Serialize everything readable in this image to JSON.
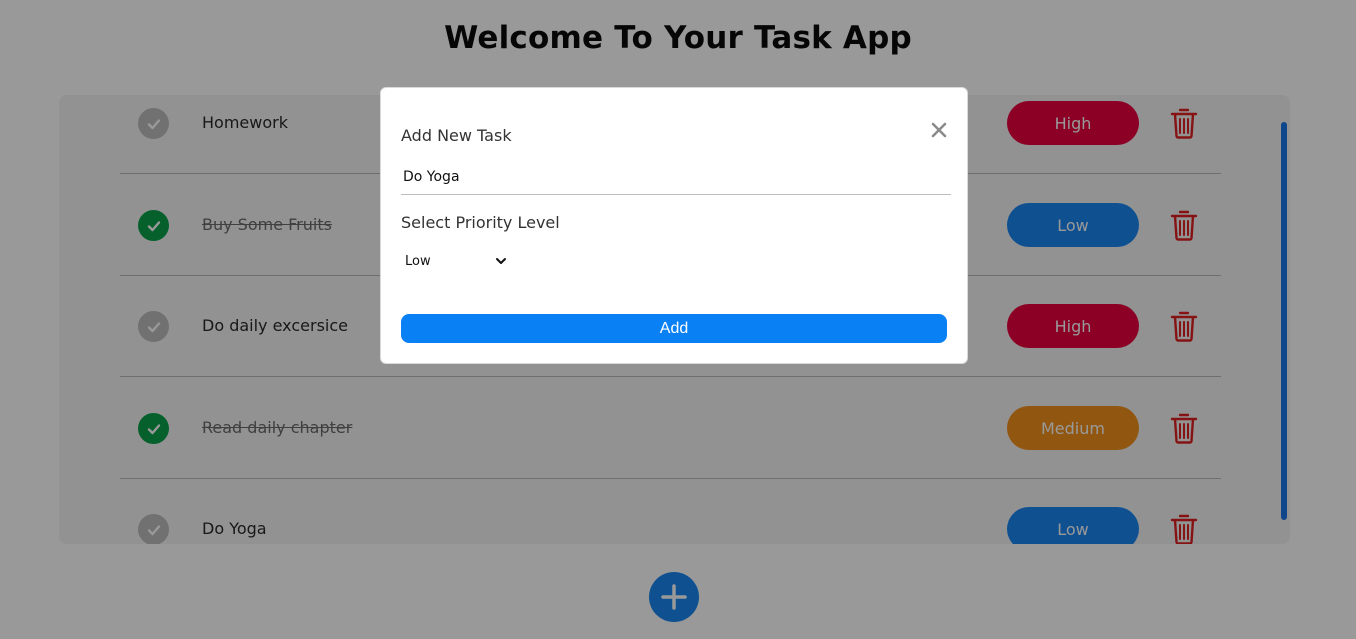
{
  "header": {
    "title": "Welcome To Your Task App"
  },
  "tasks": [
    {
      "text": "Homework",
      "done": false,
      "priority": "High"
    },
    {
      "text": "Buy Some Fruits",
      "done": true,
      "priority": "Low"
    },
    {
      "text": "Do daily excersice",
      "done": false,
      "priority": "High"
    },
    {
      "text": "Read daily chapter",
      "done": true,
      "priority": "Medium"
    },
    {
      "text": "Do Yoga",
      "done": false,
      "priority": "Low"
    }
  ],
  "priority_colors": {
    "High": "#e8003d",
    "Low": "#1a86f0",
    "Medium": "#f28f1c"
  },
  "status_colors": {
    "done": "#0aa04a",
    "pending": "#bdbdbd",
    "delete": "#e02020"
  },
  "modal": {
    "title": "Add New Task",
    "task_input_value": "Do Yoga",
    "priority_label": "Select Priority Level",
    "priority_selected": "Low",
    "add_label": "Add",
    "close_icon": "close-icon"
  },
  "fab": {
    "icon": "plus-icon"
  }
}
